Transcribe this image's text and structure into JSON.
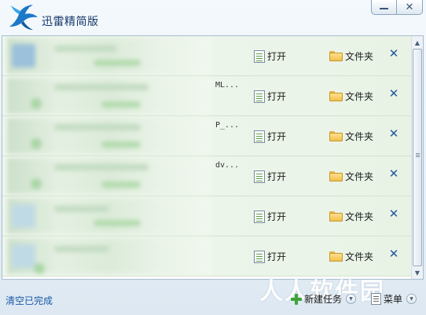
{
  "window": {
    "title": "迅雷精简版",
    "minimize_label": "—",
    "close_label": "✕"
  },
  "rows": [
    {
      "fragment": "",
      "open_label": "打开",
      "folder_label": "文件夹",
      "remove_label": "✕"
    },
    {
      "fragment": "ML...",
      "open_label": "打开",
      "folder_label": "文件夹",
      "remove_label": "✕"
    },
    {
      "fragment": "P_...",
      "open_label": "打开",
      "folder_label": "文件夹",
      "remove_label": "✕"
    },
    {
      "fragment": "dv...",
      "open_label": "打开",
      "folder_label": "文件夹",
      "remove_label": "✕"
    },
    {
      "fragment": "",
      "open_label": "打开",
      "folder_label": "文件夹",
      "remove_label": "✕"
    },
    {
      "fragment": "",
      "open_label": "打开",
      "folder_label": "文件夹",
      "remove_label": "✕"
    }
  ],
  "footer": {
    "clear_completed": "清空已完成",
    "new_task": "新建任务",
    "menu": "菜单"
  },
  "watermark": "人人软件园",
  "colors": {
    "accent": "#1a5aa8",
    "row_background": "#eaf4e8",
    "remove_icon": "#215a9a"
  }
}
